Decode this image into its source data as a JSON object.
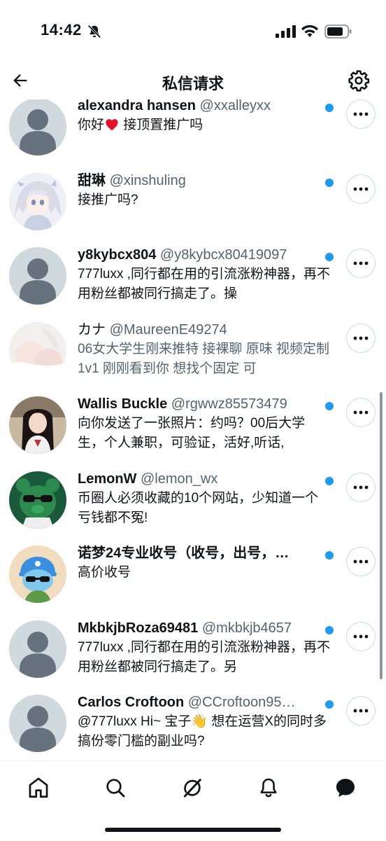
{
  "status_bar": {
    "time": "14:42"
  },
  "header": {
    "title": "私信请求"
  },
  "requests": [
    {
      "name": "alexandra hansen",
      "handle": "@xxalleyxx",
      "message": "你好",
      "message_after_emoji": "接顶置推广吗",
      "unread": true,
      "avatar": "default"
    },
    {
      "name": "甜琳",
      "handle": "@xinshuling",
      "message": "接推广吗?",
      "unread": true,
      "avatar": "anime"
    },
    {
      "name": "y8kybcx804",
      "handle": "@y8kybcx80419097",
      "message": "777luxx ,同行都在用的引流涨粉神器，再不用粉丝都被同行搞走了。操",
      "unread": true,
      "avatar": "default"
    },
    {
      "name": "カナ",
      "handle": "@MaureenE49274",
      "message": "06女大学生刚来推特 接裸聊 原味 视频定制1v1 刚刚看到你  想找个固定  可",
      "unread": false,
      "avatar": "photo-light"
    },
    {
      "name": "Wallis Buckle",
      "handle": "@rgwwz85573479",
      "message": "向你发送了一张照片：约吗？00后大学生，个人兼职，可验证，活好,听话,",
      "unread": true,
      "avatar": "photo-girl"
    },
    {
      "name": "LemonW",
      "handle": "@lemon_wx",
      "message": "币圈人必须收藏的10个网站，少知道一个亏钱都不冤!",
      "unread": true,
      "avatar": "bear"
    },
    {
      "name": "诺梦24专业收号（收号，出号，…",
      "handle": "",
      "message": "高价收号",
      "unread": true,
      "avatar": "cat"
    },
    {
      "name": "MkbkjbRoza69481",
      "handle": "@mkbkjb4657",
      "message": "777luxx ,同行都在用的引流涨粉神器，再不用粉丝都被同行搞走了。另",
      "unread": true,
      "avatar": "default"
    },
    {
      "name": "Carlos Croftoon",
      "handle": "@CCroftoon95…",
      "message": "@777luxx Hi~ 宝子",
      "message_after_emoji": "想在运营X的同时多搞份零门槛的副业吗?",
      "unread": true,
      "avatar": "default"
    }
  ],
  "tab_bar": {
    "items": [
      {
        "name": "home",
        "icon": "home-icon"
      },
      {
        "name": "search",
        "icon": "search-icon"
      },
      {
        "name": "grok",
        "icon": "grok-icon"
      },
      {
        "name": "notifications",
        "icon": "bell-icon"
      },
      {
        "name": "messages",
        "icon": "message-icon",
        "active": true
      }
    ]
  },
  "colors": {
    "accent": "#1d9bf0",
    "text": "#0f1419",
    "secondary": "#536471",
    "border": "#cfd9de"
  }
}
